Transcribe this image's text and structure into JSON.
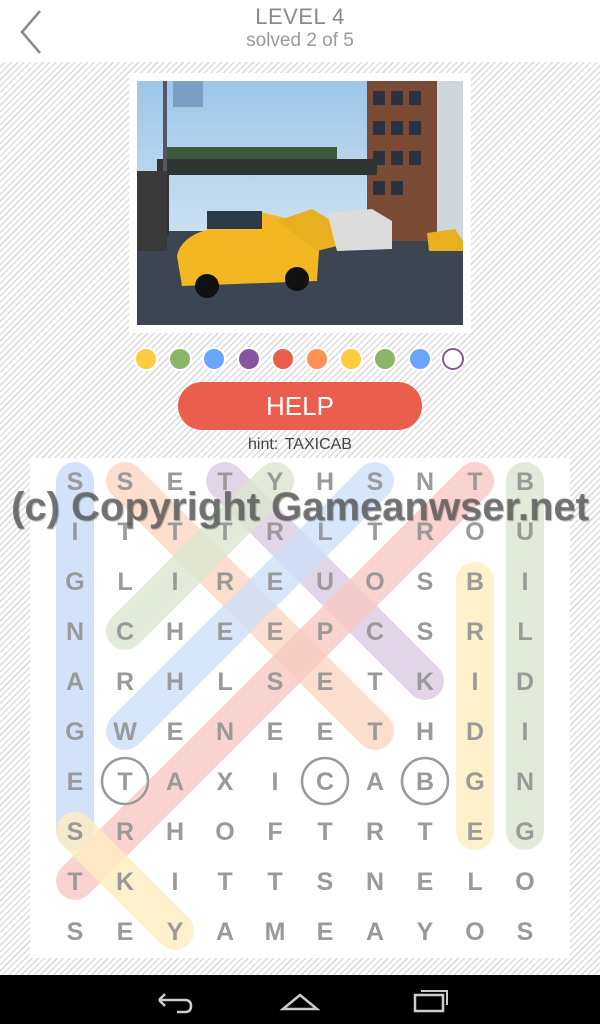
{
  "header": {
    "title": "LEVEL 4",
    "subtitle": "solved 2 of 5",
    "back_icon": "chevron-left-icon"
  },
  "progress_dots": [
    {
      "color": "#ffcc40",
      "filled": true
    },
    {
      "color": "#8db56a",
      "filled": true
    },
    {
      "color": "#6aa5ff",
      "filled": true
    },
    {
      "color": "#8a55a0",
      "filled": true
    },
    {
      "color": "#eb5e4e",
      "filled": true
    },
    {
      "color": "#ff9155",
      "filled": true
    },
    {
      "color": "#ffcc40",
      "filled": true
    },
    {
      "color": "#8db56a",
      "filled": true
    },
    {
      "color": "#6aa5ff",
      "filled": true
    },
    {
      "color": "#8a55a0",
      "filled": false
    }
  ],
  "help_label": "HELP",
  "hint": {
    "prefix": "hint:",
    "word": "TAXICAB"
  },
  "watermark": "(c) Copyright Gameanwser.net",
  "grid": {
    "rows": [
      "SSETYHSNTB",
      "ITTTRLTROU",
      "GLIREUOSBI",
      "NCHEEPCSRL",
      "ARHLSETKID",
      "GWENEETHDI",
      "ETAXICABGN",
      "SRHOFTRTEG",
      "TKITTSNELO",
      "SEYAMEAYOS"
    ],
    "found_words": [
      {
        "word": "SIGNAGES",
        "color": "#c9dcf7",
        "from": [
          0,
          0
        ],
        "to": [
          0,
          7
        ]
      },
      {
        "word": "STREET",
        "color": "#fbd7c2",
        "from": [
          1,
          0
        ],
        "to": [
          6,
          5
        ]
      },
      {
        "word": "TRUCK",
        "color": "#dccbe3",
        "from": [
          3,
          0
        ],
        "to": [
          7,
          4
        ]
      },
      {
        "word": "CITY",
        "color": "#dbe6d0",
        "from": [
          1,
          3
        ],
        "to": [
          4,
          0
        ]
      },
      {
        "word": "WHEELS",
        "color": "#cfe0f8",
        "from": [
          1,
          5
        ],
        "to": [
          6,
          0
        ]
      },
      {
        "word": "TRANSPORT",
        "color": "#f8c9c5",
        "from": [
          0,
          8
        ],
        "to": [
          8,
          0
        ]
      },
      {
        "word": "BUILDING",
        "color": "#dbe6d0",
        "from": [
          9,
          0
        ],
        "to": [
          9,
          7
        ]
      },
      {
        "word": "BRIDGE",
        "color": "#fdeec0",
        "from": [
          8,
          2
        ],
        "to": [
          8,
          7
        ]
      },
      {
        "word": "SKY",
        "color": "#fdeec0",
        "from": [
          0,
          7
        ],
        "to": [
          2,
          9
        ]
      }
    ],
    "hint_circles": [
      [
        1,
        6
      ],
      [
        5,
        6
      ],
      [
        7,
        6
      ]
    ]
  },
  "navbar": {
    "back_icon": "nav-back-icon",
    "home_icon": "nav-home-icon",
    "recents_icon": "nav-recents-icon"
  }
}
